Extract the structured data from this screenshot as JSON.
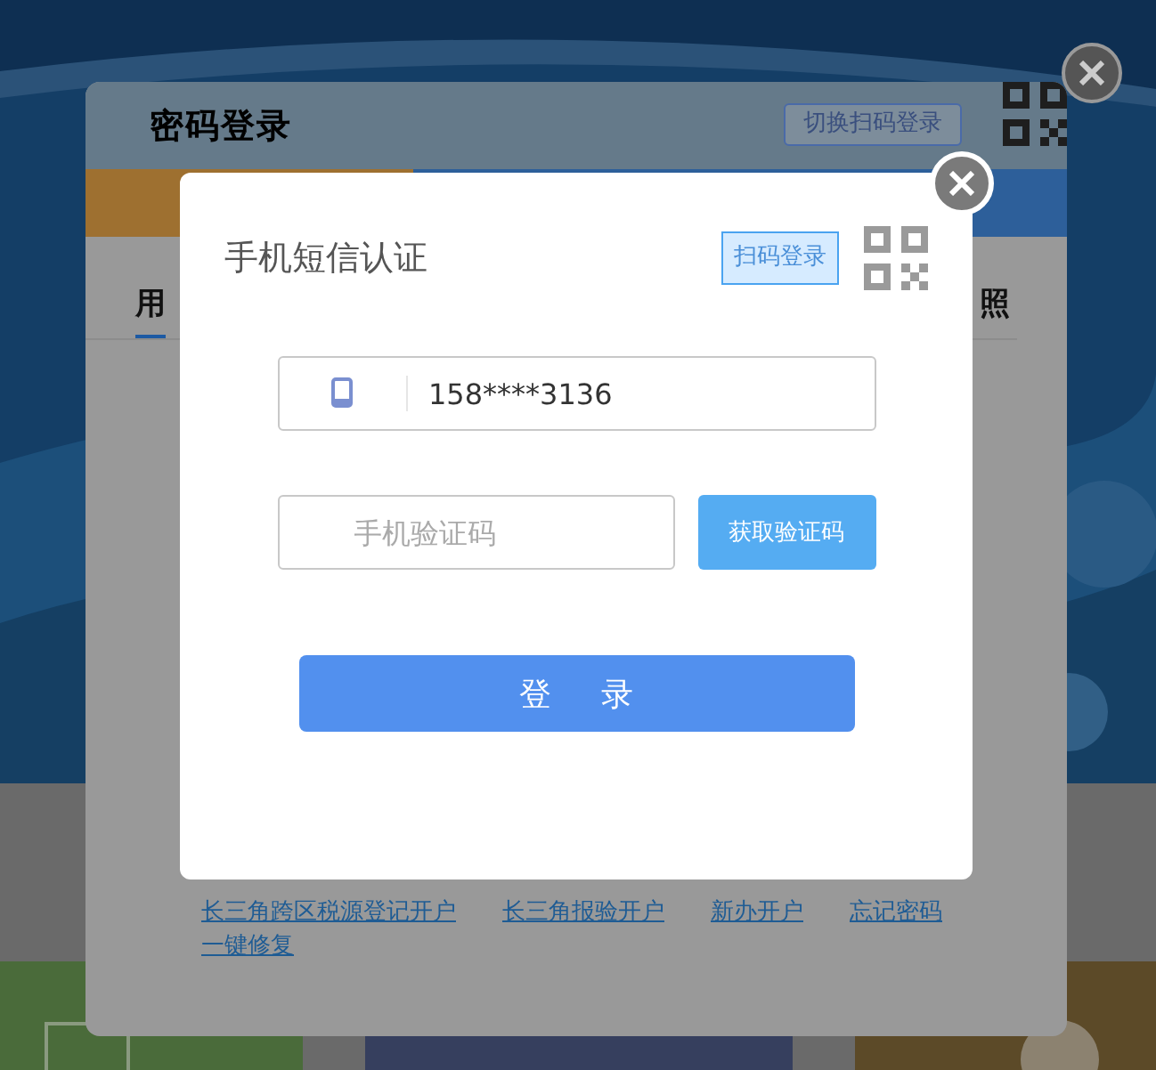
{
  "background_dialog": {
    "title": "密码登录",
    "switch_tag": "切换扫码登录",
    "tabs": [
      {
        "selected": true
      },
      {
        "selected": false
      },
      {
        "selected": false
      }
    ],
    "sub_tabs": [
      {
        "text": "用",
        "selected": true
      },
      {
        "text": "照",
        "selected": false
      }
    ],
    "links": [
      "长三角跨区税源登记开户",
      "长三角报验开户",
      "新办开户",
      "忘记密码",
      "一键修复"
    ]
  },
  "sms_dialog": {
    "title": "手机短信认证",
    "scan_tag": "扫码登录",
    "phone": {
      "value": "158****3136"
    },
    "code": {
      "placeholder": "手机验证码"
    },
    "get_code_button": "获取验证码",
    "login_button": "登 录"
  }
}
